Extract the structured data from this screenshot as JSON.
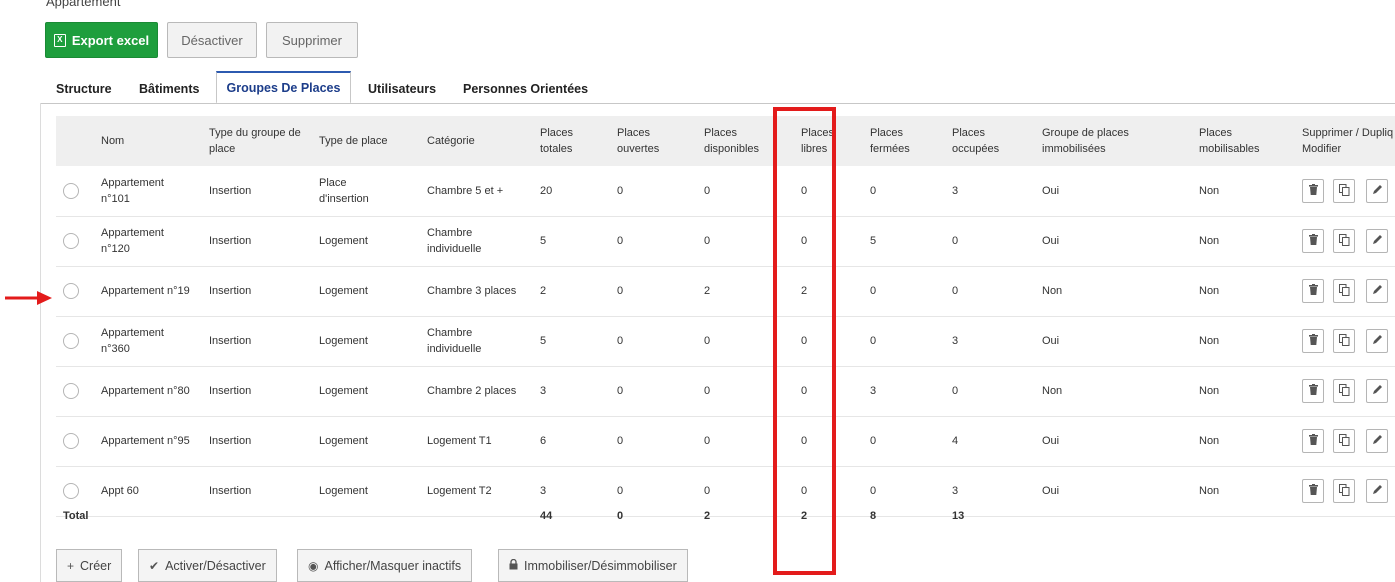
{
  "breadcrumb": "Appartement",
  "toolbar": {
    "export_label": "Export excel",
    "export_icon": "excel-icon",
    "deactivate_label": "Désactiver",
    "delete_label": "Supprimer"
  },
  "tabs": [
    "Structure",
    "Bâtiments",
    "Groupes De Places",
    "Utilisateurs",
    "Personnes Orientées"
  ],
  "active_tab": "Groupes De Places",
  "columns": {
    "nom": "Nom",
    "type_groupe": [
      "Type du groupe de",
      "place"
    ],
    "type_place": "Type de place",
    "categorie": "Catégorie",
    "totales": [
      "Places",
      "totales"
    ],
    "ouvertes": [
      "Places",
      "ouvertes"
    ],
    "disponibles": [
      "Places",
      "disponibles"
    ],
    "libres": [
      "Places",
      "libres"
    ],
    "fermees": [
      "Places",
      "fermées"
    ],
    "occupees": [
      "Places",
      "occupées"
    ],
    "immobilisees": [
      "Groupe de places",
      "immobilisées"
    ],
    "mobilisables": [
      "Places",
      "mobilisables"
    ],
    "actions": [
      "Supprimer / Dupliq",
      "Modifier"
    ]
  },
  "rows": [
    {
      "nom": [
        "Appartement",
        "n°101"
      ],
      "type_groupe": "Insertion",
      "type_place": [
        "Place",
        "d'insertion"
      ],
      "categorie": [
        "Chambre 5 et +"
      ],
      "totales": "20",
      "ouvertes": "0",
      "disponibles": "0",
      "libres": "0",
      "fermees": "0",
      "occupees": "3",
      "immobilisees": "Oui",
      "mobilisables": "Non"
    },
    {
      "nom": [
        "Appartement",
        "n°120"
      ],
      "type_groupe": "Insertion",
      "type_place": [
        "Logement"
      ],
      "categorie": [
        "Chambre",
        "individuelle"
      ],
      "totales": "5",
      "ouvertes": "0",
      "disponibles": "0",
      "libres": "0",
      "fermees": "5",
      "occupees": "0",
      "immobilisees": "Oui",
      "mobilisables": "Non"
    },
    {
      "nom": [
        "Appartement n°19"
      ],
      "type_groupe": "Insertion",
      "type_place": [
        "Logement"
      ],
      "categorie": [
        "Chambre 3 places"
      ],
      "totales": "2",
      "ouvertes": "0",
      "disponibles": "2",
      "libres": "2",
      "fermees": "0",
      "occupees": "0",
      "immobilisees": "Non",
      "mobilisables": "Non"
    },
    {
      "nom": [
        "Appartement",
        "n°360"
      ],
      "type_groupe": "Insertion",
      "type_place": [
        "Logement"
      ],
      "categorie": [
        "Chambre",
        "individuelle"
      ],
      "totales": "5",
      "ouvertes": "0",
      "disponibles": "0",
      "libres": "0",
      "fermees": "0",
      "occupees": "3",
      "immobilisees": "Oui",
      "mobilisables": "Non"
    },
    {
      "nom": [
        "Appartement n°80"
      ],
      "type_groupe": "Insertion",
      "type_place": [
        "Logement"
      ],
      "categorie": [
        "Chambre 2 places"
      ],
      "totales": "3",
      "ouvertes": "0",
      "disponibles": "0",
      "libres": "0",
      "fermees": "3",
      "occupees": "0",
      "immobilisees": "Non",
      "mobilisables": "Non"
    },
    {
      "nom": [
        "Appartement n°95"
      ],
      "type_groupe": "Insertion",
      "type_place": [
        "Logement"
      ],
      "categorie": [
        "Logement T1"
      ],
      "totales": "6",
      "ouvertes": "0",
      "disponibles": "0",
      "libres": "0",
      "fermees": "0",
      "occupees": "4",
      "immobilisees": "Oui",
      "mobilisables": "Non"
    },
    {
      "nom": [
        "Appt 60"
      ],
      "type_groupe": "Insertion",
      "type_place": [
        "Logement"
      ],
      "categorie": [
        "Logement T2"
      ],
      "totales": "3",
      "ouvertes": "0",
      "disponibles": "0",
      "libres": "0",
      "fermees": "0",
      "occupees": "3",
      "immobilisees": "Oui",
      "mobilisables": "Non"
    }
  ],
  "row_actions": {
    "delete_icon": "trash-icon",
    "duplicate_icon": "copy-icon",
    "edit_icon": "pencil-icon"
  },
  "totals": {
    "label": "Total",
    "totales": "44",
    "ouvertes": "0",
    "disponibles": "2",
    "libres": "2",
    "fermees": "8",
    "occupees": "13"
  },
  "bottom_buttons": [
    {
      "label": "Créer",
      "icon": "plus-icon"
    },
    {
      "label": "Activer/Désactiver",
      "icon": "check-icon"
    },
    {
      "label": "Afficher/Masquer inactifs",
      "icon": "eye-icon"
    },
    {
      "label": "Immobiliser/Désimmobiliser",
      "icon": "lock-icon"
    }
  ],
  "colors": {
    "export_green": "#1e9e3d",
    "active_tab_blue": "#1c3d8a",
    "highlight_red": "#e31b1b"
  }
}
